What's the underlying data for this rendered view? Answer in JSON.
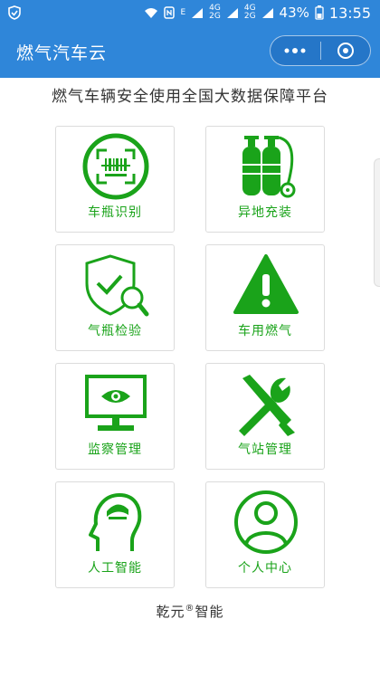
{
  "statusbar": {
    "net_e": "E",
    "net_4g_top": "4G",
    "net_4g_bottom": "2G",
    "net_4g2_top": "4G",
    "net_4g2_bottom": "2G",
    "battery": "43%",
    "time": "13:55"
  },
  "appbar": {
    "title": "燃气汽车云"
  },
  "subtitle": "燃气车辆安全使用全国大数据保障平台",
  "grid": [
    {
      "label": "车瓶识别",
      "icon": "scan-barcode-icon"
    },
    {
      "label": "异地充装",
      "icon": "gas-cylinder-icon"
    },
    {
      "label": "气瓶检验",
      "icon": "shield-inspect-icon"
    },
    {
      "label": "车用燃气",
      "icon": "warning-icon"
    },
    {
      "label": "监察管理",
      "icon": "monitor-eye-icon"
    },
    {
      "label": "气站管理",
      "icon": "tools-icon"
    },
    {
      "label": "人工智能",
      "icon": "ai-head-icon"
    },
    {
      "label": "个人中心",
      "icon": "user-icon"
    }
  ],
  "footer": {
    "brand": "乾元",
    "registered": "®",
    "suffix": "智能"
  },
  "colors": {
    "brand_blue": "#2f86d9",
    "icon_green": "#1aa31a"
  }
}
